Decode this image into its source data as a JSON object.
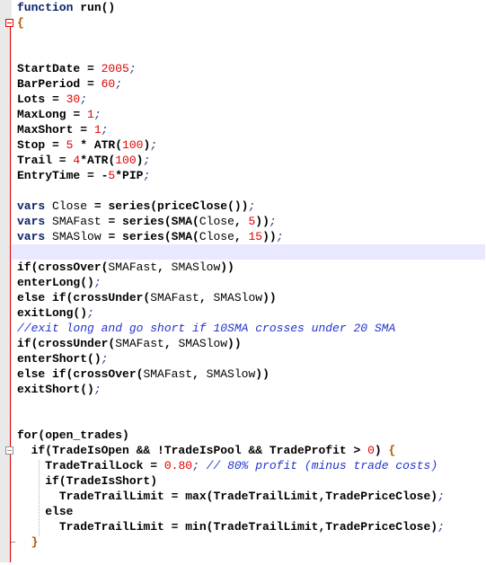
{
  "editor": {
    "language": "lite-C",
    "current_line_index": 16,
    "lines": [
      {
        "indent": 0,
        "tokens": [
          {
            "t": "kw",
            "v": "function"
          },
          {
            "t": "plain",
            "v": " run()"
          }
        ]
      },
      {
        "indent": 0,
        "tokens": [
          {
            "t": "brace",
            "v": "{"
          }
        ]
      },
      {
        "indent": 0,
        "tokens": []
      },
      {
        "indent": 0,
        "tokens": []
      },
      {
        "indent": 0,
        "tokens": [
          {
            "t": "plain",
            "v": "StartDate = "
          },
          {
            "t": "num",
            "v": "2005"
          },
          {
            "t": "semi",
            "v": ";"
          }
        ]
      },
      {
        "indent": 0,
        "tokens": [
          {
            "t": "plain",
            "v": "BarPeriod = "
          },
          {
            "t": "num",
            "v": "60"
          },
          {
            "t": "semi",
            "v": ";"
          }
        ]
      },
      {
        "indent": 0,
        "tokens": [
          {
            "t": "plain",
            "v": "Lots = "
          },
          {
            "t": "num",
            "v": "30"
          },
          {
            "t": "semi",
            "v": ";"
          }
        ]
      },
      {
        "indent": 0,
        "tokens": [
          {
            "t": "plain",
            "v": "MaxLong = "
          },
          {
            "t": "num",
            "v": "1"
          },
          {
            "t": "semi",
            "v": ";"
          }
        ]
      },
      {
        "indent": 0,
        "tokens": [
          {
            "t": "plain",
            "v": "MaxShort = "
          },
          {
            "t": "num",
            "v": "1"
          },
          {
            "t": "semi",
            "v": ";"
          }
        ]
      },
      {
        "indent": 0,
        "tokens": [
          {
            "t": "plain",
            "v": "Stop = "
          },
          {
            "t": "num",
            "v": "5"
          },
          {
            "t": "plain",
            "v": " * ATR("
          },
          {
            "t": "num",
            "v": "100"
          },
          {
            "t": "plain",
            "v": ")"
          },
          {
            "t": "semi",
            "v": ";"
          }
        ]
      },
      {
        "indent": 0,
        "tokens": [
          {
            "t": "plain",
            "v": "Trail = "
          },
          {
            "t": "num",
            "v": "4"
          },
          {
            "t": "plain",
            "v": "*ATR("
          },
          {
            "t": "num",
            "v": "100"
          },
          {
            "t": "plain",
            "v": ")"
          },
          {
            "t": "semi",
            "v": ";"
          }
        ]
      },
      {
        "indent": 0,
        "tokens": [
          {
            "t": "plain",
            "v": "EntryTime = -"
          },
          {
            "t": "num",
            "v": "5"
          },
          {
            "t": "plain",
            "v": "*PIP"
          },
          {
            "t": "semi",
            "v": ";"
          }
        ]
      },
      {
        "indent": 0,
        "tokens": []
      },
      {
        "indent": 0,
        "tokens": [
          {
            "t": "kw",
            "v": "vars"
          },
          {
            "t": "plain",
            "v": " "
          },
          {
            "t": "idb",
            "v": "Close"
          },
          {
            "t": "plain",
            "v": " = series(priceClose())"
          },
          {
            "t": "semi",
            "v": ";"
          }
        ]
      },
      {
        "indent": 0,
        "tokens": [
          {
            "t": "kw",
            "v": "vars"
          },
          {
            "t": "plain",
            "v": " "
          },
          {
            "t": "idb",
            "v": "SMAFast"
          },
          {
            "t": "plain",
            "v": " = series(SMA("
          },
          {
            "t": "idb",
            "v": "Close"
          },
          {
            "t": "plain",
            "v": ", "
          },
          {
            "t": "num",
            "v": "5"
          },
          {
            "t": "plain",
            "v": "))"
          },
          {
            "t": "semi",
            "v": ";"
          }
        ]
      },
      {
        "indent": 0,
        "tokens": [
          {
            "t": "kw",
            "v": "vars"
          },
          {
            "t": "plain",
            "v": " "
          },
          {
            "t": "idb",
            "v": "SMASlow"
          },
          {
            "t": "plain",
            "v": " = series(SMA("
          },
          {
            "t": "idb",
            "v": "Close"
          },
          {
            "t": "plain",
            "v": ", "
          },
          {
            "t": "num",
            "v": "15"
          },
          {
            "t": "plain",
            "v": "))"
          },
          {
            "t": "semi",
            "v": ";"
          }
        ]
      },
      {
        "indent": 0,
        "tokens": []
      },
      {
        "indent": 0,
        "tokens": [
          {
            "t": "plain",
            "v": "if(crossOver("
          },
          {
            "t": "idb",
            "v": "SMAFast"
          },
          {
            "t": "plain",
            "v": ", "
          },
          {
            "t": "idb",
            "v": "SMASlow"
          },
          {
            "t": "plain",
            "v": "))"
          }
        ]
      },
      {
        "indent": 0,
        "tokens": [
          {
            "t": "plain",
            "v": "enterLong()"
          },
          {
            "t": "semi",
            "v": ";"
          }
        ]
      },
      {
        "indent": 0,
        "tokens": [
          {
            "t": "plain",
            "v": "else if(crossUnder("
          },
          {
            "t": "idb",
            "v": "SMAFast"
          },
          {
            "t": "plain",
            "v": ", "
          },
          {
            "t": "idb",
            "v": "SMASlow"
          },
          {
            "t": "plain",
            "v": "))"
          }
        ]
      },
      {
        "indent": 0,
        "tokens": [
          {
            "t": "plain",
            "v": "exitLong()"
          },
          {
            "t": "semi",
            "v": ";"
          }
        ]
      },
      {
        "indent": 0,
        "tokens": [
          {
            "t": "cm",
            "v": "//exit long and go short if 10SMA crosses under 20 SMA"
          }
        ]
      },
      {
        "indent": 0,
        "tokens": [
          {
            "t": "plain",
            "v": "if(crossUnder("
          },
          {
            "t": "idb",
            "v": "SMAFast"
          },
          {
            "t": "plain",
            "v": ", "
          },
          {
            "t": "idb",
            "v": "SMASlow"
          },
          {
            "t": "plain",
            "v": "))"
          }
        ]
      },
      {
        "indent": 0,
        "tokens": [
          {
            "t": "plain",
            "v": "enterShort()"
          },
          {
            "t": "semi",
            "v": ";"
          }
        ]
      },
      {
        "indent": 0,
        "tokens": [
          {
            "t": "plain",
            "v": "else if(crossOver("
          },
          {
            "t": "idb",
            "v": "SMAFast"
          },
          {
            "t": "plain",
            "v": ", "
          },
          {
            "t": "idb",
            "v": "SMASlow"
          },
          {
            "t": "plain",
            "v": "))"
          }
        ]
      },
      {
        "indent": 0,
        "tokens": [
          {
            "t": "plain",
            "v": "exitShort()"
          },
          {
            "t": "semi",
            "v": ";"
          }
        ]
      },
      {
        "indent": 0,
        "tokens": []
      },
      {
        "indent": 0,
        "tokens": []
      },
      {
        "indent": 0,
        "tokens": [
          {
            "t": "plain",
            "v": "for(open_trades)"
          }
        ]
      },
      {
        "indent": 2,
        "tokens": [
          {
            "t": "plain",
            "v": "if(TradeIsOpen && !TradeIsPool && TradeProfit > "
          },
          {
            "t": "num",
            "v": "0"
          },
          {
            "t": "plain",
            "v": ") "
          },
          {
            "t": "brace",
            "v": "{"
          }
        ]
      },
      {
        "indent": 4,
        "tokens": [
          {
            "t": "plain",
            "v": "TradeTrailLock = "
          },
          {
            "t": "num",
            "v": "0.80"
          },
          {
            "t": "semi",
            "v": ";"
          },
          {
            "t": "cm",
            "v": " // 80% profit (minus trade costs)"
          }
        ]
      },
      {
        "indent": 4,
        "tokens": [
          {
            "t": "plain",
            "v": "if(TradeIsShort)"
          }
        ]
      },
      {
        "indent": 6,
        "tokens": [
          {
            "t": "plain",
            "v": "TradeTrailLimit = max(TradeTrailLimit,TradePriceClose)"
          },
          {
            "t": "semi",
            "v": ";"
          }
        ]
      },
      {
        "indent": 4,
        "tokens": [
          {
            "t": "plain",
            "v": "else"
          }
        ]
      },
      {
        "indent": 6,
        "tokens": [
          {
            "t": "plain",
            "v": "TradeTrailLimit = min(TradeTrailLimit,TradePriceClose)"
          },
          {
            "t": "semi",
            "v": ";"
          }
        ]
      },
      {
        "indent": 2,
        "tokens": [
          {
            "t": "brace",
            "v": "}"
          }
        ]
      },
      {
        "indent": 0,
        "tokens": []
      }
    ]
  }
}
